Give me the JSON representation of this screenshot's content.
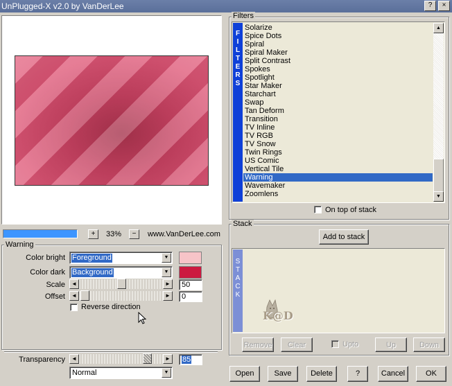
{
  "window": {
    "title": "UnPlugged-X v2.0 by VanDerLee",
    "help_button": "?",
    "close_button": "×"
  },
  "preview": {
    "zoom_plus": "+",
    "zoom_value": "33%",
    "zoom_minus": "−",
    "website": "www.VanDerLee.com"
  },
  "effect_group": {
    "title": "Warning",
    "color_bright_label": "Color bright",
    "color_bright_value": "Foreground",
    "color_bright_swatch": "#f7c4c8",
    "color_dark_label": "Color dark",
    "color_dark_value": "Background",
    "color_dark_swatch": "#cc1a40",
    "scale_label": "Scale",
    "scale_value": "50",
    "scale_level": 0.5,
    "offset_label": "Offset",
    "offset_value": "0",
    "offset_level": 0,
    "reverse_label": "Reverse direction"
  },
  "transparency": {
    "label": "Transparency",
    "value": "85",
    "blend_mode": "Normal"
  },
  "filters": {
    "title": "Filters",
    "side_label": [
      "F",
      "I",
      "L",
      "T",
      "E",
      "R",
      "S"
    ],
    "items": [
      "Solarize",
      "Spice Dots",
      "Spiral",
      "Spiral Maker",
      "Split Contrast",
      "Spokes",
      "Spotlight",
      "Star Maker",
      "Starchart",
      "Swap",
      "Tan Deform",
      "Transition",
      "TV Inline",
      "TV RGB",
      "TV Snow",
      "Twin Rings",
      "US Comic",
      "Vertical Tile",
      "Warning",
      "Wavemaker",
      "Zoomlens"
    ],
    "selected": "Warning",
    "on_top_label": "On top of stack"
  },
  "stack": {
    "title": "Stack",
    "add_button": "Add to stack",
    "side_label": [
      "S",
      "T",
      "A",
      "C",
      "K"
    ],
    "watermark": "K@D",
    "remove_button": "Remove",
    "clear_button": "Clear",
    "upto_label": "Upto",
    "up_button": "Up",
    "down_button": "Down"
  },
  "footer": {
    "open": "Open",
    "save": "Save",
    "delete": "Delete",
    "help": "?",
    "cancel": "Cancel",
    "ok": "OK"
  }
}
